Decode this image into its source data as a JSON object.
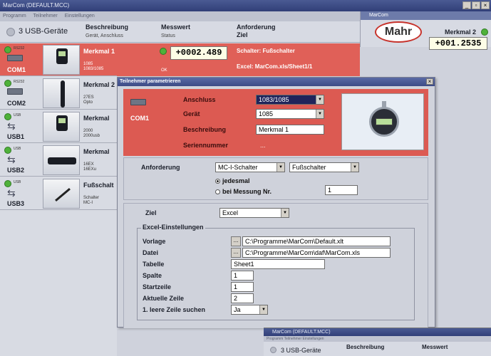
{
  "window": {
    "title": "MarCom (DEFAULT.MCC)",
    "menu": [
      "Programm",
      "Teilnehmer",
      "Einstellungen"
    ]
  },
  "header": {
    "count": "3 USB-Geräte",
    "col1": "Beschreibung",
    "col1_sub": "Gerät, Anschluss",
    "col2": "Messwert",
    "col2_sub": "Status",
    "col3": "Anforderung",
    "col3_sub": "Ziel"
  },
  "rows": [
    {
      "port": "COM1",
      "name": "Merkmal 1",
      "sub1": "1085",
      "sub2": "1083/1085",
      "value": "+0002.489",
      "status": "OK",
      "req": "Schalter: Fußschalter",
      "target": "Excel: MarCom.xls/Sheet1/1"
    },
    {
      "port": "COM2",
      "name": "Merkmal 2",
      "sub1": "27ES",
      "sub2": "Opto"
    },
    {
      "port": "USB1",
      "name": "Merkmal",
      "sub1": "2000",
      "sub2": "2000usb"
    },
    {
      "port": "USB2",
      "name": "Merkmal",
      "sub1": "16EX",
      "sub2": "16EXu"
    },
    {
      "port": "USB3",
      "name": "Fußschalt",
      "sub1": "Schalter",
      "sub2": "MC-I"
    }
  ],
  "panel": {
    "title": "MarCom",
    "logo": "Mahr",
    "merkmal": "Merkmal 2",
    "value": "+001.2535"
  },
  "dialog": {
    "title": "Teilnehmer parametrieren",
    "port": "COM1",
    "anschluss_label": "Anschluss",
    "anschluss": "1083/1085",
    "geraet_label": "Gerät",
    "geraet": "1085",
    "beschreibung_label": "Beschreibung",
    "beschreibung": "Merkmal 1",
    "seriennummer_label": "Seriennummer",
    "seriennummer": "...",
    "anforderung_label": "Anforderung",
    "anforderung": "MC-I-Schalter",
    "anforderung2": "Fußschalter",
    "radio1": "jedesmal",
    "radio2": "bei Messung Nr.",
    "messung_nr": "1",
    "ziel_label": "Ziel",
    "ziel": "Excel",
    "excel_group": "Excel-Einstellungen",
    "vorlage_label": "Vorlage",
    "vorlage": "C:\\Programme\\MarCom\\Default.xlt",
    "datei_label": "Datei",
    "datei": "C:\\Programme\\MarCom\\daf\\MarCom.xls",
    "tabelle_label": "Tabelle",
    "tabelle": "Sheet1",
    "spalte_label": "Spalte",
    "spalte": "1",
    "startzeile_label": "Startzeile",
    "startzeile": "1",
    "aktuelle_label": "Aktuelle Zeile",
    "aktuelle": "2",
    "leere_label": "1. leere Zeile suchen",
    "leere": "Ja"
  },
  "bottom": {
    "title": "MarCom (DEFAULT.MCC)",
    "count": "3 USB-Geräte",
    "col1": "Beschreibung",
    "col2": "Messwert"
  }
}
